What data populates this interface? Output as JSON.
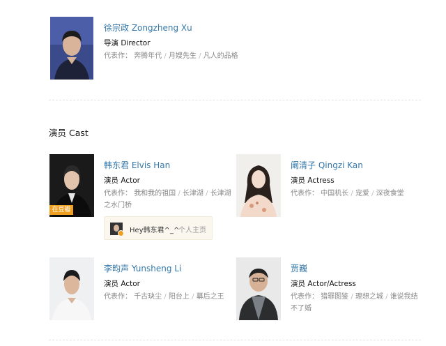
{
  "director": {
    "name": "徐宗政 Zongzheng Xu",
    "role": "导演 Director",
    "works_prefix": "代表作：",
    "works": [
      "奔腾年代",
      "月嫂先生",
      "凡人的品格"
    ]
  },
  "cast_section": {
    "title": "演员 Cast"
  },
  "cast": [
    {
      "name": "韩东君 Elvis Han",
      "role": "演员 Actor",
      "works_prefix": "代表作：",
      "works": [
        "我和我的祖国",
        "长津湖",
        "长津湖之水门桥"
      ],
      "tag": "在豆瓣",
      "hey": {
        "text": "Hey韩东君^_^",
        "link": "个人主页"
      }
    },
    {
      "name": "阚清子 Qingzi Kan",
      "role": "演员 Actress",
      "works_prefix": "代表作：",
      "works": [
        "中国机长",
        "宠爱",
        "深夜食堂"
      ]
    },
    {
      "name": "李昀声 Yunsheng Li",
      "role": "演员 Actor",
      "works_prefix": "代表作：",
      "works": [
        "千古玦尘",
        "阳台上",
        "幕后之王"
      ]
    },
    {
      "name": "贾巍",
      "role": "演员 Actor/Actress",
      "works_prefix": "代表作：",
      "works": [
        "猎罪图鉴",
        "理想之城",
        "谁说我结不了婚"
      ]
    }
  ],
  "colors": {
    "link": "#3377aa",
    "muted": "#888888",
    "tag": "#f0a020",
    "hey_bg": "#fbf7ef"
  }
}
